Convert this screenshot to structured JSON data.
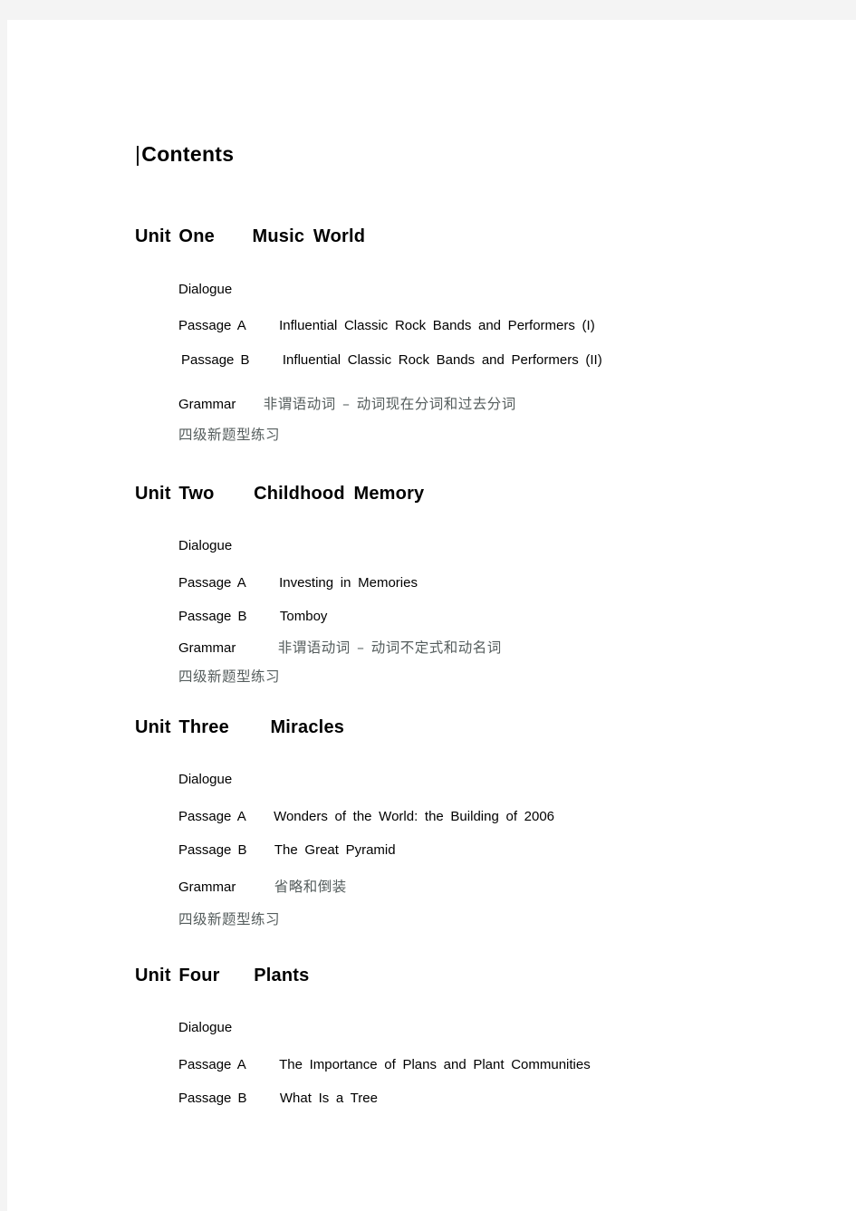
{
  "document": {
    "title_bar": "|",
    "title": "Contents"
  },
  "units": [
    {
      "heading_label": "Unit One",
      "heading_title": "Music World",
      "entries": [
        {
          "label": "Dialogue",
          "text": ""
        },
        {
          "label": "Passage A",
          "text": "Influential Classic Rock Bands and Performers (I)"
        },
        {
          "label": "Passage B",
          "text": "Influential Classic Rock Bands and Performers (II)"
        },
        {
          "label": "Grammar",
          "text": "非谓语动词 – 动词现在分词和过去分词"
        },
        {
          "label": "",
          "text": "四级新题型练习"
        }
      ]
    },
    {
      "heading_label": "Unit Two",
      "heading_title": "Childhood Memory",
      "entries": [
        {
          "label": "Dialogue",
          "text": ""
        },
        {
          "label": "Passage A",
          "text": "Investing in Memories"
        },
        {
          "label": "Passage B",
          "text": "Tomboy"
        },
        {
          "label": "Grammar",
          "text": "非谓语动词 – 动词不定式和动名词"
        },
        {
          "label": "",
          "text": "四级新题型练习"
        }
      ]
    },
    {
      "heading_label": "Unit Three",
      "heading_title": "Miracles",
      "entries": [
        {
          "label": "Dialogue",
          "text": ""
        },
        {
          "label": "Passage A",
          "text": "Wonders of the World: the Building of 2006"
        },
        {
          "label": "Passage B",
          "text": "The Great Pyramid"
        },
        {
          "label": "Grammar",
          "text": "省略和倒装"
        },
        {
          "label": "",
          "text": "四级新题型练习"
        }
      ]
    },
    {
      "heading_label": "Unit Four",
      "heading_title": "Plants",
      "entries": [
        {
          "label": "Dialogue",
          "text": ""
        },
        {
          "label": "Passage A",
          "text": "The Importance of Plans and Plant Communities"
        },
        {
          "label": "Passage B",
          "text": "What Is a Tree"
        }
      ]
    }
  ]
}
